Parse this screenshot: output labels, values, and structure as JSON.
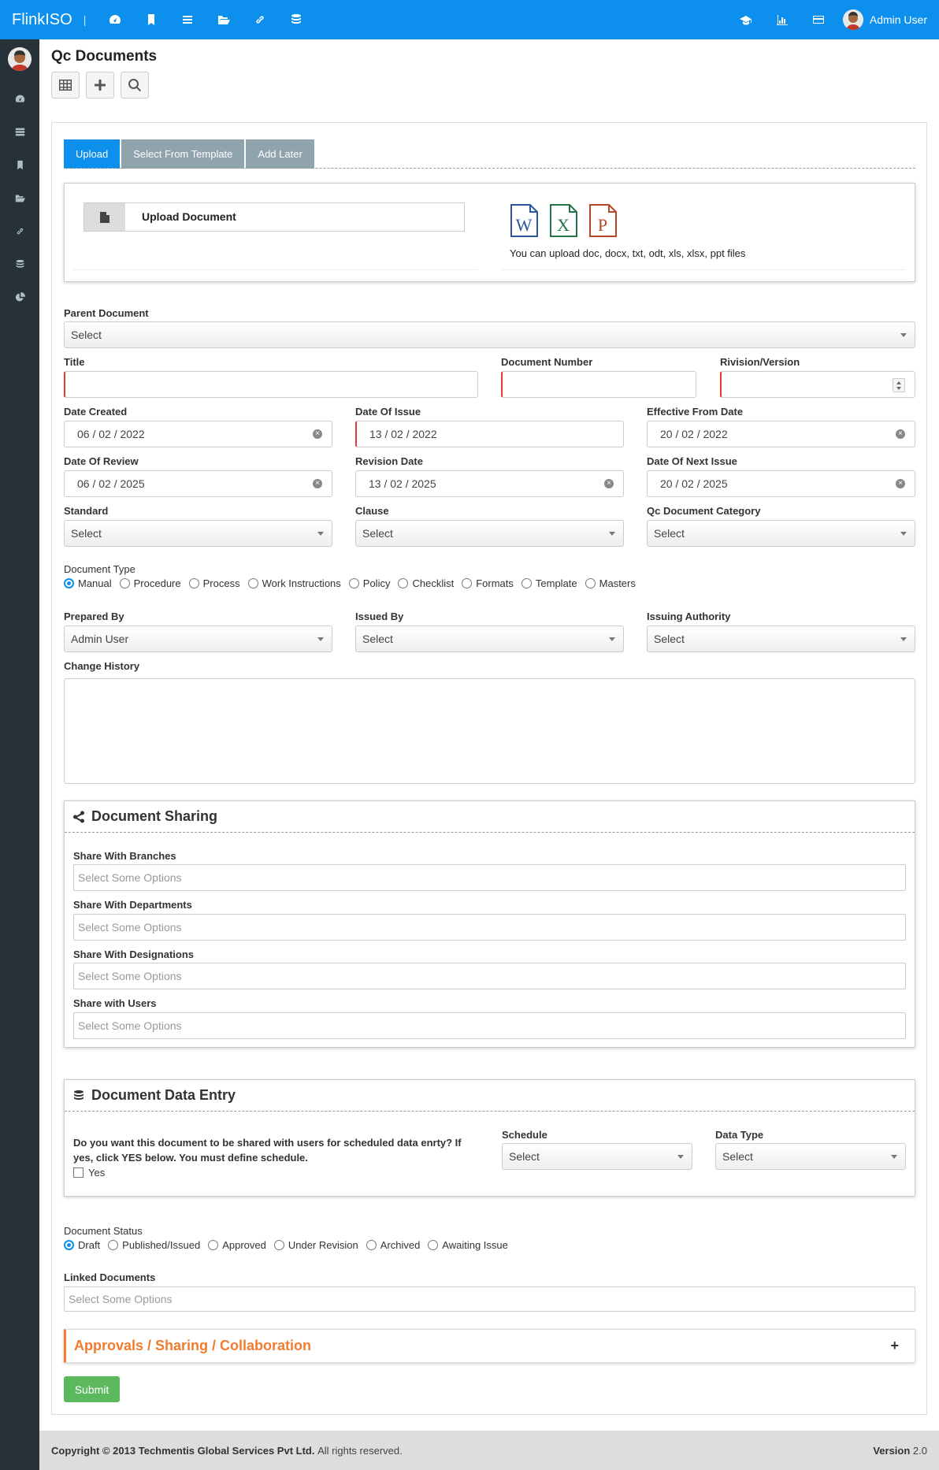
{
  "topbar": {
    "brand": "FlinkISO",
    "separator": "|",
    "icons": [
      "dashboard-icon",
      "bookmark-icon",
      "list-icon",
      "folder-open-icon",
      "link-icon",
      "database-icon"
    ],
    "right_icons": [
      "graduation-cap-icon",
      "bar-chart-icon",
      "credit-card-icon"
    ],
    "user_name": "Admin User"
  },
  "sidebar": {
    "icons": [
      "dashboard-icon",
      "server-icon",
      "bookmark-icon",
      "folder-open-icon",
      "link-icon",
      "database-icon",
      "pie-chart-icon"
    ]
  },
  "page": {
    "title": "Qc Documents",
    "toolbar": [
      "table-icon",
      "plus-icon",
      "search-icon"
    ]
  },
  "tabs": [
    "Upload",
    "Select From Template",
    "Add Later"
  ],
  "upload": {
    "button_label": "Upload Document",
    "file_icons": [
      "word-file-icon",
      "excel-file-icon",
      "powerpoint-file-icon"
    ],
    "word_letter": "W",
    "excel_letter": "X",
    "ppt_letter": "P",
    "info": "You can upload doc, docx, txt, odt, xls, xlsx, ppt files"
  },
  "form": {
    "parent_document": {
      "label": "Parent Document",
      "value": "Select"
    },
    "title": {
      "label": "Title",
      "value": ""
    },
    "document_number": {
      "label": "Document Number",
      "value": ""
    },
    "revision_version": {
      "label": "Rivision/Version",
      "value": ""
    },
    "date_created": {
      "label": "Date Created",
      "value": "06 / 02 / 2022"
    },
    "date_of_issue": {
      "label": "Date Of Issue",
      "value": "13 / 02 / 2022"
    },
    "effective_from_date": {
      "label": "Effective From Date",
      "value": "20 / 02 / 2022"
    },
    "date_of_review": {
      "label": "Date Of Review",
      "value": "06 / 02 / 2025"
    },
    "revision_date": {
      "label": "Revision Date",
      "value": "13 / 02 / 2025"
    },
    "date_of_next_issue": {
      "label": "Date Of Next Issue",
      "value": "20 / 02 / 2025"
    },
    "standard": {
      "label": "Standard",
      "value": "Select"
    },
    "clause": {
      "label": "Clause",
      "value": "Select"
    },
    "category": {
      "label": "Qc Document Category",
      "value": "Select"
    },
    "document_type": {
      "label": "Document Type",
      "options": [
        "Manual",
        "Procedure",
        "Process",
        "Work Instructions",
        "Policy",
        "Checklist",
        "Formats",
        "Template",
        "Masters"
      ],
      "selected": "Manual"
    },
    "prepared_by": {
      "label": "Prepared By",
      "value": "Admin User"
    },
    "issued_by": {
      "label": "Issued By",
      "value": "Select"
    },
    "issuing_authority": {
      "label": "Issuing Authority",
      "value": "Select"
    },
    "change_history": {
      "label": "Change History",
      "value": ""
    }
  },
  "sharing": {
    "title": "Document Sharing",
    "branches": {
      "label": "Share With Branches",
      "placeholder": "Select Some Options"
    },
    "departments": {
      "label": "Share With Departments",
      "placeholder": "Select Some Options"
    },
    "designations": {
      "label": "Share With Designations",
      "placeholder": "Select Some Options"
    },
    "users": {
      "label": "Share with Users",
      "placeholder": "Select Some Options"
    }
  },
  "data_entry": {
    "title": "Document Data Entry",
    "question_line1": "Do you want this document to be shared with users for scheduled data enrty? If",
    "question_line2": "yes, click YES below. You must define schedule.",
    "yes_label": "Yes",
    "schedule": {
      "label": "Schedule",
      "value": "Select"
    },
    "data_type": {
      "label": "Data Type",
      "value": "Select"
    }
  },
  "status": {
    "label": "Document Status",
    "options": [
      "Draft",
      "Published/Issued",
      "Approved",
      "Under Revision",
      "Archived",
      "Awaiting Issue"
    ],
    "selected": "Draft"
  },
  "linked": {
    "label": "Linked Documents",
    "placeholder": "Select Some Options"
  },
  "approvals": {
    "title": "Approvals / Sharing / Collaboration",
    "toggle": "+"
  },
  "submit_label": "Submit",
  "footer": {
    "copyright_prefix": "Copyright © 2013",
    "company": "Techmentis Global Services Pvt Ltd.",
    "rights": "All rights reserved.",
    "version_label": "Version",
    "version": "2.0"
  },
  "colors": {
    "primary": "#0c8fed",
    "sidebar": "#263238",
    "tab_inactive": "#90a4ae",
    "accent_orange": "#f07c30",
    "submit_green": "#5cb85c",
    "error_border": "#e53935"
  }
}
